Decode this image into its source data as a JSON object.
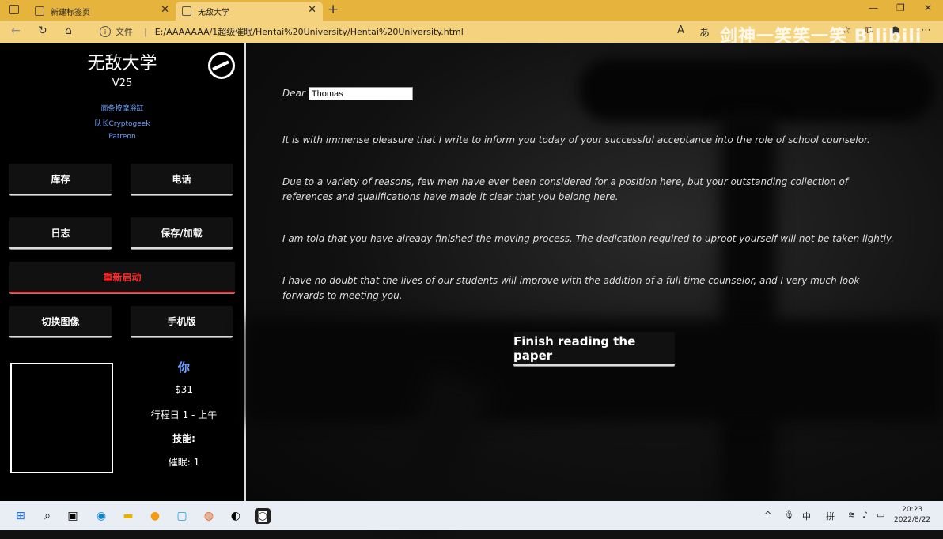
{
  "browser": {
    "tabs": [
      {
        "label": "新建标签页",
        "active": false
      },
      {
        "label": "无敌大学",
        "active": true
      }
    ],
    "file_label": "文件",
    "url": "E:/AAAAAAA/1超级催眠/Hentai%20University/Hentai%20University.html",
    "watermark": "剑神一笑笑一笑 Bilibili"
  },
  "sidebar": {
    "title": "无敌大学",
    "version": "V25",
    "links": [
      "面条按摩浴缸",
      "队长Cryptogeek",
      "Patreon"
    ],
    "buttons": {
      "inventory": "库存",
      "phone": "电话",
      "journal": "日志",
      "save_load": "保存/加载",
      "restart": "重新启动",
      "switch_image": "切换图像",
      "mobile": "手机版"
    },
    "stats": {
      "you": "你",
      "money": "$31",
      "day": "行程日 1 - 上午",
      "skills_label": "技能:",
      "hypnosis": "催眠:  1"
    }
  },
  "letter": {
    "dear": "Dear",
    "name_value": "Thomas",
    "paragraphs": [
      "It is with immense pleasure that I write to inform you today of your successful acceptance into the role of school counselor.",
      "Due to a variety of reasons, few men have ever been considered for a position here, but your outstanding collection of references and qualifications have made it clear that you belong here.",
      "I am told that you have already finished the moving process. The dedication required to uproot yourself will not be taken lightly.",
      "I have no doubt that the lives of our students will improve with the addition of a full time counselor, and I very much look forwards to meeting you."
    ],
    "finish_button": "Finish reading the paper"
  },
  "taskbar": {
    "ime1": "中",
    "ime2": "拼",
    "time": "20:23",
    "date": "2022/8/22"
  }
}
